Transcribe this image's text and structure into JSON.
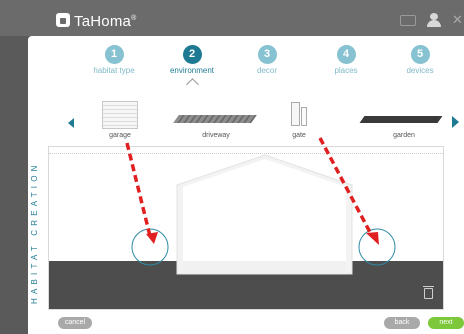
{
  "app": {
    "title": "TaHoma",
    "trademark": "®"
  },
  "header_icons": [
    "mail-icon",
    "user-icon",
    "close-icon"
  ],
  "steps": [
    {
      "number": "1",
      "label": "habitat type",
      "active": false
    },
    {
      "number": "2",
      "label": "environment",
      "active": true
    },
    {
      "number": "3",
      "label": "decor",
      "active": false
    },
    {
      "number": "4",
      "label": "places",
      "active": false
    },
    {
      "number": "5",
      "label": "devices",
      "active": false
    }
  ],
  "environment_items": [
    {
      "label": "garage",
      "icon": "garage-icon"
    },
    {
      "label": "driveway",
      "icon": "driveway-icon"
    },
    {
      "label": "gate",
      "icon": "gate-icon"
    },
    {
      "label": "garden",
      "icon": "garden-icon"
    }
  ],
  "side_title": "HABITAT CREATION",
  "buttons": {
    "cancel": "cancel",
    "back": "back",
    "next": "next"
  },
  "colors": {
    "accent": "#1e7a93",
    "step_inactive": "#86c2d1",
    "next_button": "#7dc83a",
    "drag_arrow": "#e02020"
  }
}
